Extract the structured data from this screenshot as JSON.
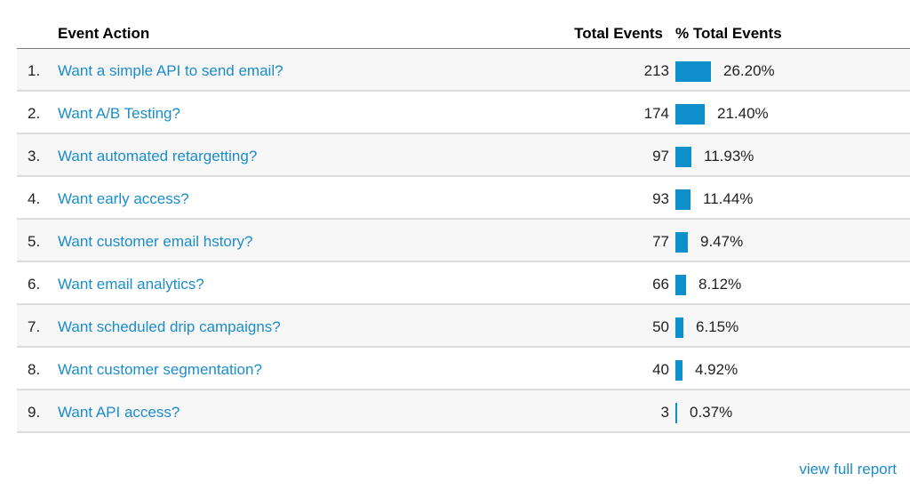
{
  "table": {
    "headers": {
      "action": "Event Action",
      "total": "Total Events",
      "percent": "% Total Events"
    },
    "rows": [
      {
        "index": "1.",
        "action": "Want a simple API to send email?",
        "total": "213",
        "percent_label": "26.20%",
        "percent": 26.2
      },
      {
        "index": "2.",
        "action": "Want A/B Testing?",
        "total": "174",
        "percent_label": "21.40%",
        "percent": 21.4
      },
      {
        "index": "3.",
        "action": "Want automated retargetting?",
        "total": "97",
        "percent_label": "11.93%",
        "percent": 11.93
      },
      {
        "index": "4.",
        "action": "Want early access?",
        "total": "93",
        "percent_label": "11.44%",
        "percent": 11.44
      },
      {
        "index": "5.",
        "action": "Want customer email hstory?",
        "total": "77",
        "percent_label": "9.47%",
        "percent": 9.47
      },
      {
        "index": "6.",
        "action": "Want email analytics?",
        "total": "66",
        "percent_label": "8.12%",
        "percent": 8.12
      },
      {
        "index": "7.",
        "action": "Want scheduled drip campaigns?",
        "total": "50",
        "percent_label": "6.15%",
        "percent": 6.15
      },
      {
        "index": "8.",
        "action": "Want customer segmentation?",
        "total": "40",
        "percent_label": "4.92%",
        "percent": 4.92
      },
      {
        "index": "9.",
        "action": "Want API access?",
        "total": "3",
        "percent_label": "0.37%",
        "percent": 0.37
      }
    ]
  },
  "footer": {
    "link_label": "view full report"
  },
  "colors": {
    "link": "#1b8ccc",
    "bar": "#0e8fcc",
    "alt_row": "#f7f7f7"
  }
}
